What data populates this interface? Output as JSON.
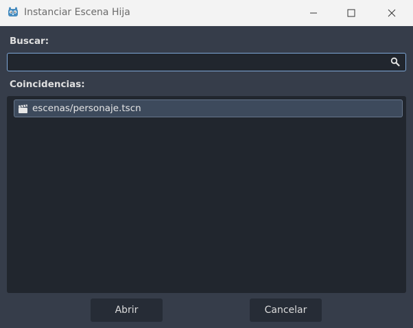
{
  "window": {
    "title": "Instanciar Escena Hija",
    "controls": {
      "minimize": "minimize-icon",
      "maximize": "maximize-icon",
      "close": "close-icon"
    }
  },
  "search": {
    "label": "Buscar:",
    "value": "",
    "icon": "search-icon"
  },
  "matches": {
    "label": "Coincidencias:",
    "items": [
      {
        "label": "escenas/personaje.tscn",
        "icon": "scene-clapperboard-icon",
        "selected": true
      }
    ]
  },
  "buttons": {
    "open": "Abrir",
    "cancel": "Cancelar"
  },
  "colors": {
    "background": "#363d4a",
    "panel": "#21262e",
    "accent": "#7fa8d9",
    "selection": "#3d4a5c"
  }
}
